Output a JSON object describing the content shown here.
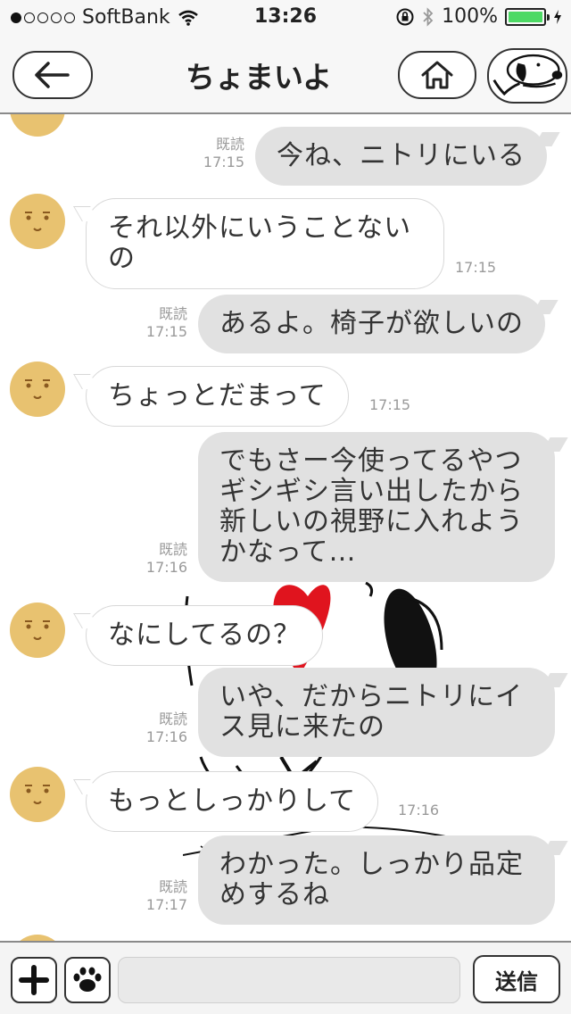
{
  "status_bar": {
    "carrier": "SoftBank",
    "time": "13:26",
    "battery": "100%",
    "signal_bars": 1
  },
  "header": {
    "title": "ちょまいよ"
  },
  "messages": [
    {
      "from": "me",
      "text": "今ね、ニトリにいる",
      "time": "17:15",
      "read": "既読"
    },
    {
      "from": "them",
      "text": "それ以外にいうことないの",
      "time": "17:15"
    },
    {
      "from": "me",
      "text": "あるよ。椅子が欲しいの",
      "time": "17:15",
      "read": "既読"
    },
    {
      "from": "them",
      "text": "ちょっとだまって",
      "time": "17:15"
    },
    {
      "from": "me",
      "text": "でもさー今使ってるやつギシギシ言い出したから新しいの視野に入れようかなって…",
      "time": "17:16",
      "read": "既読"
    },
    {
      "from": "them",
      "text": "なにしてるの？",
      "time": "17:16"
    },
    {
      "from": "me",
      "text": "いや、だからニトリにイス見に来たの",
      "time": "17:16",
      "read": "既読"
    },
    {
      "from": "them",
      "text": "もっとしっかりして",
      "time": "17:16"
    },
    {
      "from": "me",
      "text": "わかった。しっかり品定めするね",
      "time": "17:17",
      "read": "既読"
    }
  ],
  "input": {
    "send_label": "送信",
    "value": ""
  },
  "colors": {
    "out_bubble": "#e1e1e1",
    "in_bubble": "#ffffff",
    "battery": "#4cd964"
  }
}
